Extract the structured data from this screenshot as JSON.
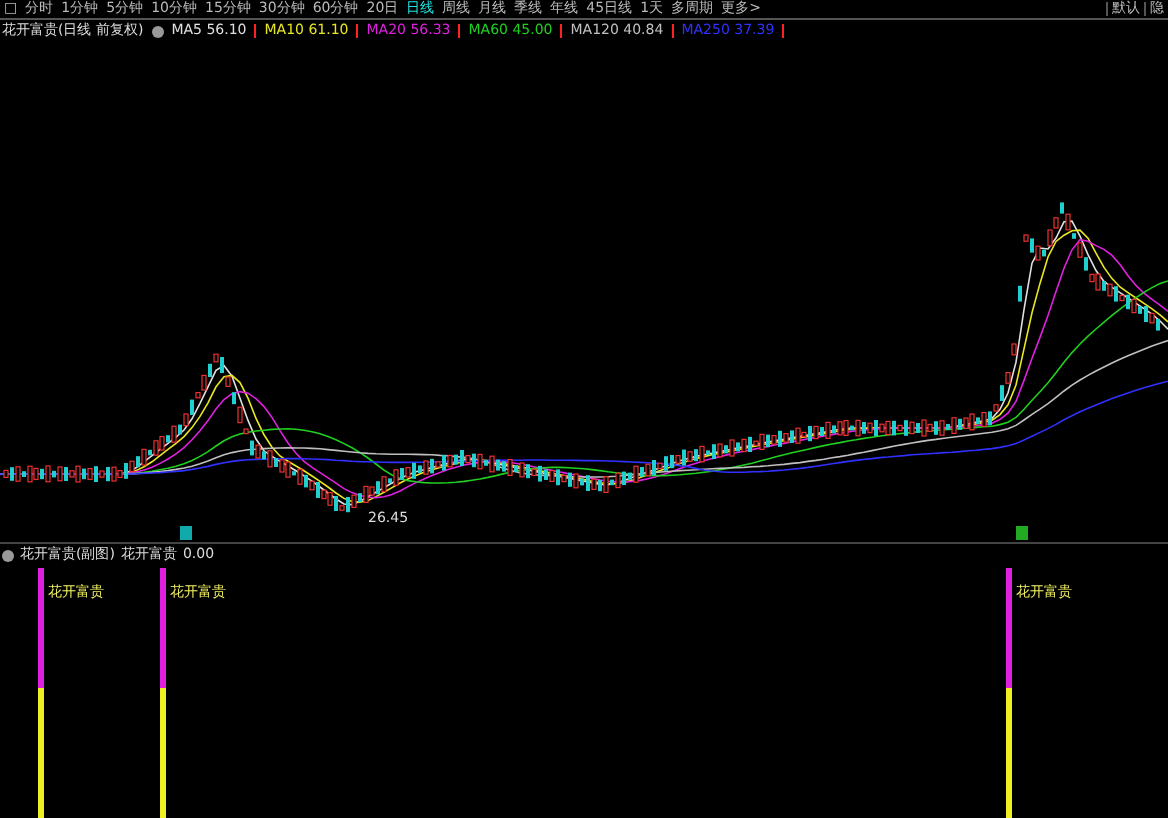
{
  "toolbar": {
    "tabs": [
      {
        "label": "□",
        "selected": false
      },
      {
        "label": "分时",
        "selected": false
      },
      {
        "label": "1分钟",
        "selected": false
      },
      {
        "label": "5分钟",
        "selected": false
      },
      {
        "label": "10分钟",
        "selected": false
      },
      {
        "label": "15分钟",
        "selected": false
      },
      {
        "label": "30分钟",
        "selected": false
      },
      {
        "label": "60分钟",
        "selected": false
      },
      {
        "label": "20日",
        "selected": false
      },
      {
        "label": "日线",
        "selected": true
      },
      {
        "label": "周线",
        "selected": false
      },
      {
        "label": "月线",
        "selected": false
      },
      {
        "label": "季线",
        "selected": false
      },
      {
        "label": "年线",
        "selected": false
      },
      {
        "label": "45日线",
        "selected": false
      },
      {
        "label": "1天",
        "selected": false
      },
      {
        "label": "多周期",
        "selected": false
      },
      {
        "label": "更多>",
        "selected": false
      }
    ],
    "right_buttons": [
      "默认",
      "隐"
    ]
  },
  "main_chart": {
    "title": "花开富贵(日线 前复权)",
    "legend": [
      {
        "label": "MA5 56.10",
        "color": "#e0e0e0"
      },
      {
        "label": "MA10 61.10",
        "color": "#e8e820"
      },
      {
        "label": "MA20 56.33",
        "color": "#e020e0"
      },
      {
        "label": "MA60 45.00",
        "color": "#20d020"
      },
      {
        "label": "MA120 40.84",
        "color": "#c0c0c0"
      },
      {
        "label": "MA250 37.39",
        "color": "#3030ff"
      }
    ],
    "low_label": "26.45"
  },
  "sub_chart": {
    "title": "花开富贵(副图)",
    "legend": "花开富贵",
    "value": "0.00",
    "signals": [
      "花开富贵",
      "花开富贵",
      "花开富贵"
    ]
  }
}
